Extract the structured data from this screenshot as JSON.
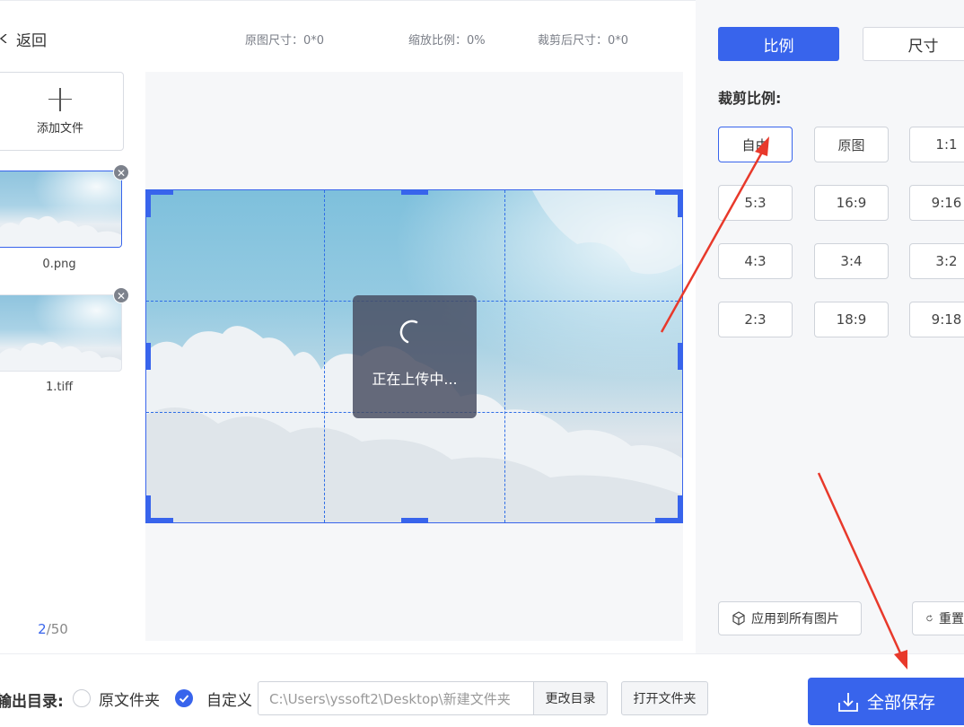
{
  "header": {
    "back_label": "返回",
    "orig_size": "原图尺寸：0*0",
    "scale": "缩放比例：0%",
    "crop_size": "裁剪后尺寸：0*0"
  },
  "files": {
    "add_label": "添加文件",
    "items": [
      {
        "name": "0.png"
      },
      {
        "name": "1.tiff"
      }
    ],
    "pager_current": "2",
    "pager_total": "/50"
  },
  "canvas": {
    "uploading_text": "正在上传中..."
  },
  "panel": {
    "tab_ratio": "比例",
    "tab_size": "尺寸",
    "section_title": "裁剪比例:",
    "ratios": [
      "自由",
      "原图",
      "1:1",
      "5:3",
      "16:9",
      "9:16",
      "4:3",
      "3:4",
      "3:2",
      "2:3",
      "18:9",
      "9:18"
    ],
    "apply_all": "应用到所有图片",
    "reset": "重置"
  },
  "bottom": {
    "output_label": "输出目录:",
    "option_original": "原文件夹",
    "option_custom": "自定义",
    "path_value": "C:\\Users\\yssoft2\\Desktop\\新建文件夹",
    "change_dir": "更改目录",
    "open_folder": "打开文件夹",
    "save_all": "全部保存"
  },
  "colors": {
    "accent": "#3864ec",
    "annotation_arrow": "#e8392b"
  }
}
